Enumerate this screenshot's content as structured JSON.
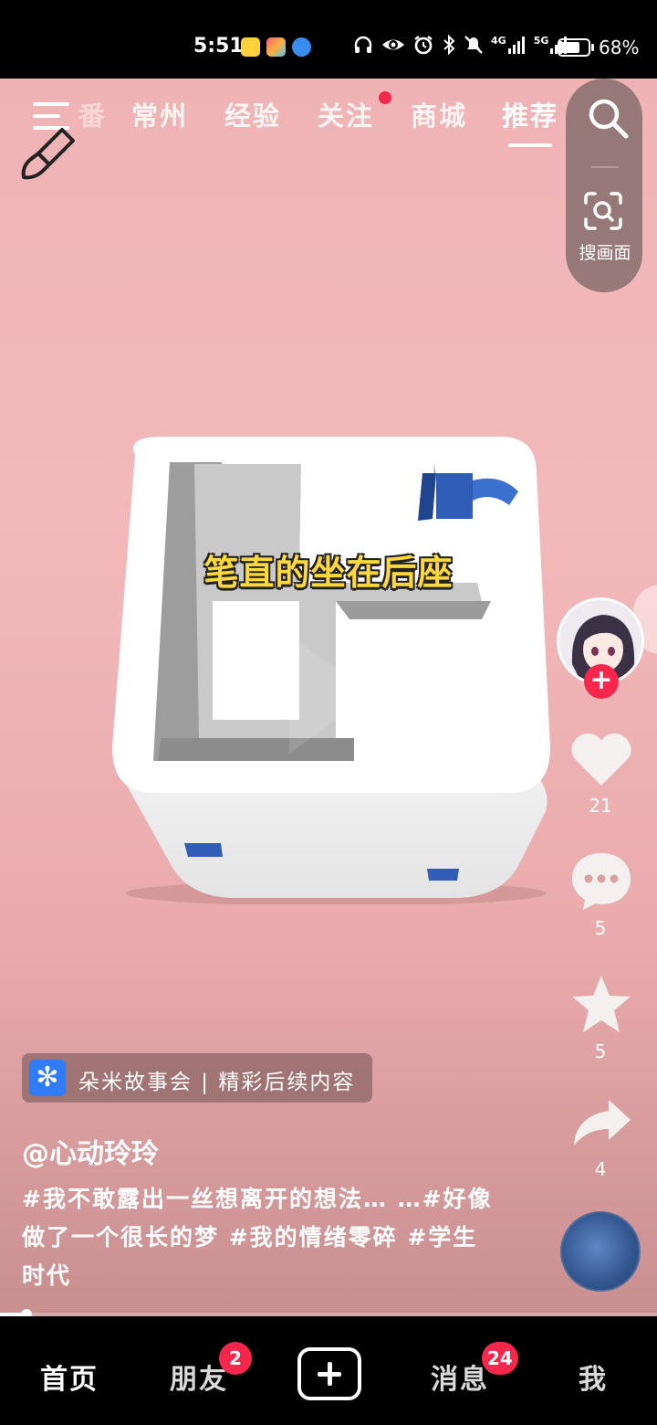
{
  "status_bar": {
    "time": "5:51",
    "battery_pct": "68%",
    "battery_level": 0.68,
    "network_labels": [
      "4G",
      "5G"
    ]
  },
  "nav": {
    "tabs": [
      {
        "label": "番",
        "state": "faded"
      },
      {
        "label": "常州",
        "state": "normal"
      },
      {
        "label": "经验",
        "state": "normal"
      },
      {
        "label": "关注",
        "state": "normal",
        "has_dot": true
      },
      {
        "label": "商城",
        "state": "normal"
      },
      {
        "label": "推荐",
        "state": "active"
      }
    ],
    "scan_label": "搜画面"
  },
  "video": {
    "caption": "笔直的坐在后座",
    "colors": {
      "background": "#f2b6b7",
      "cube": "#ffffff",
      "accent_blue": "#2f5db8"
    }
  },
  "rail": {
    "likes": "21",
    "comments": "5",
    "favorites": "5",
    "shares": "4",
    "follow_symbol": "+"
  },
  "info": {
    "promo_text": "朵米故事会 | 精彩后续内容",
    "author": "@心动玲玲",
    "description": "#我不敢露出一丝想离开的想法… …#好像做了一个很长的梦 #我的情绪零碎 #学生时代"
  },
  "playback": {
    "progress": 0.04
  },
  "tab_bar": {
    "home": "首页",
    "friends": "朋友",
    "friends_badge": "2",
    "messages": "消息",
    "messages_badge": "24",
    "me": "我"
  }
}
